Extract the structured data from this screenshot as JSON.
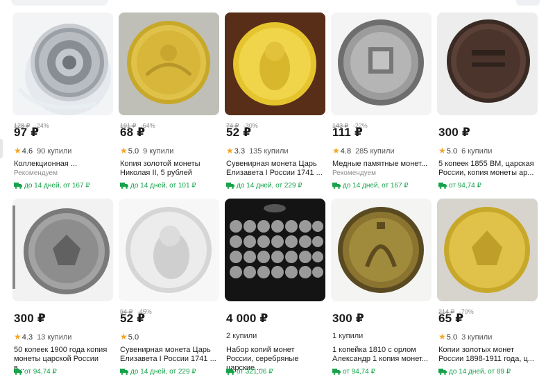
{
  "currency": "₽",
  "colors": {
    "accent_green": "#16a34a",
    "star": "#f5a623",
    "price": "#1b1b1b"
  },
  "products": [
    {
      "old_price": "128 ₽",
      "discount": "-24%",
      "price": "97 ₽",
      "rating": "4.6",
      "buys": "90 купили",
      "title": "Коллекционная ...",
      "note": "Рекомендуем",
      "delivery": "до 14 дней, от 167 ₽",
      "icon": "silver-calendar-coin"
    },
    {
      "old_price": "191 ₽",
      "discount": "-64%",
      "price": "68 ₽",
      "rating": "5.0",
      "buys": "9 купили",
      "title": "Копия золотой монеты Николая II, 5 рублей",
      "delivery": "до 14 дней, от 101 ₽",
      "icon": "gold-coin-copy"
    },
    {
      "old_price": "74 ₽",
      "discount": "-30%",
      "price": "52 ₽",
      "rating": "3.3",
      "buys": "135 купили",
      "title": "Сувенирная монета Царь Елизавета I России 1741 ...",
      "delivery": "до 14 дней, от 229 ₽",
      "icon": "gold-portrait-coin"
    },
    {
      "old_price": "143 ₽",
      "discount": "-22%",
      "price": "111 ₽",
      "rating": "4.8",
      "buys": "285 купили",
      "title": "Медные памятные монет...",
      "note": "Рекомендуем",
      "delivery": "до 14 дней, от 167 ₽",
      "icon": "silver-monogram-coin"
    },
    {
      "price": "300 ₽",
      "rating": "5.0",
      "buys": "6 купили",
      "title": "5 копеек 1855 ВМ, царская России, копия монеты ар...",
      "delivery": "от 94,74 ₽",
      "icon": "copper-5-kopeks-coin"
    },
    {
      "price": "300 ₽",
      "rating": "4.3",
      "buys": "13 купили",
      "title": "50 копеек 1900 года копия монеты царской России в...",
      "delivery": "от 94,74 ₽",
      "icon": "silver-eagle-coin"
    },
    {
      "old_price": "94 ₽",
      "discount": "-45%",
      "price": "52 ₽",
      "rating": "5.0",
      "title": "Сувенирная монета Царь Елизавета I России 1741 ...",
      "delivery": "до 14 дней, от 229 ₽",
      "icon": "silver-portrait-coin"
    },
    {
      "price": "4 000 ₽",
      "buys": "2 купили",
      "title": "Набор копий монет России, серебряные царские ...",
      "delivery": "от 321,06 ₽",
      "icon": "coin-set"
    },
    {
      "price": "300 ₽",
      "buys": "1 купили",
      "title": "1 копейка 1810 с орлом Александр 1 копия монет...",
      "delivery": "от 94,74 ₽",
      "icon": "brass-monogram-coin"
    },
    {
      "old_price": "214 ₽",
      "discount": "-70%",
      "price": "65 ₽",
      "rating": "5.0",
      "buys": "3 купили",
      "title": "Копии золотых монет России 1898-1911 года, ц...",
      "delivery": "до 14 дней, от 89 ₽",
      "icon": "gold-eagle-coin"
    }
  ]
}
